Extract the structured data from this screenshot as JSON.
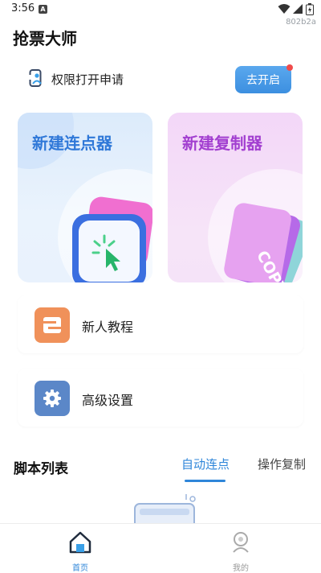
{
  "status_bar": {
    "time": "3:56",
    "notification_icon": "A"
  },
  "build_tag": "802b2a",
  "app_title": "抢票大师",
  "permission": {
    "label": "权限打开申请",
    "button_label": "去开启",
    "icon": "person-badge-icon"
  },
  "cards": [
    {
      "title": "新建连点器",
      "icon": "tap-cursor-icon"
    },
    {
      "title": "新建复制器",
      "icon": "copy-cards-icon",
      "illustration_text": "COPY"
    }
  ],
  "menu": [
    {
      "label": "新人教程",
      "icon": "tutorial-icon",
      "color": "#f0915a"
    },
    {
      "label": "高级设置",
      "icon": "gear-icon",
      "color": "#5b87c8"
    }
  ],
  "script_list": {
    "title": "脚本列表",
    "tabs": [
      {
        "label": "自动连点",
        "active": true
      },
      {
        "label": "操作复制",
        "active": false
      }
    ]
  },
  "bottom_nav": [
    {
      "label": "首页",
      "icon": "home-icon",
      "active": true
    },
    {
      "label": "我的",
      "icon": "profile-icon",
      "active": false
    }
  ],
  "colors": {
    "accent": "#2f86d9",
    "left_card_title": "#2f78d8",
    "right_card_title": "#a23fd0",
    "badge": "#f04b4b"
  }
}
